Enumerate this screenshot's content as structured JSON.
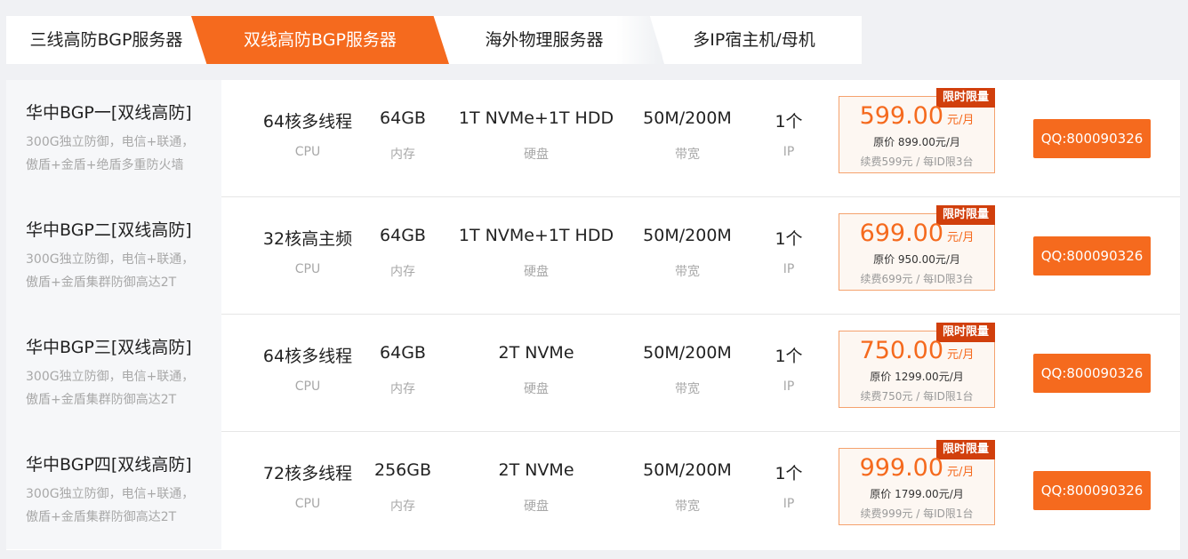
{
  "tabs": [
    {
      "label": "三线高防BGP服务器",
      "active": false
    },
    {
      "label": "双线高防BGP服务器",
      "active": true
    },
    {
      "label": "海外物理服务器",
      "active": false
    },
    {
      "label": "多IP宿主机/母机",
      "active": false
    }
  ],
  "colors": {
    "accent": "#f56a1e",
    "promo_badge": "#d13f0c"
  },
  "products": [
    {
      "name": "华中BGP一[双线高防]",
      "desc": "300G独立防御，电信+联通，傲盾+金盾+绝盾多重防火墙",
      "cpu": "64核多线程",
      "cpu_label": "CPU",
      "mem": "64GB",
      "mem_label": "内存",
      "disk": "1T NVMe+1T HDD",
      "disk_label": "硬盘",
      "bw": "50M/200M",
      "bw_label": "带宽",
      "ip": "1个",
      "ip_label": "IP",
      "badge": "限时限量",
      "price": "599.00",
      "unit": "元/月",
      "original": "原价 899.00元/月",
      "renew": "续费599元 / 每ID限3台",
      "contact": "QQ:800090326"
    },
    {
      "name": "华中BGP二[双线高防]",
      "desc": "300G独立防御，电信+联通，傲盾+金盾集群防御高达2T",
      "cpu": "32核高主频",
      "cpu_label": "CPU",
      "mem": "64GB",
      "mem_label": "内存",
      "disk": "1T NVMe+1T HDD",
      "disk_label": "硬盘",
      "bw": "50M/200M",
      "bw_label": "带宽",
      "ip": "1个",
      "ip_label": "IP",
      "badge": "限时限量",
      "price": "699.00",
      "unit": "元/月",
      "original": "原价 950.00元/月",
      "renew": "续费699元 / 每ID限3台",
      "contact": "QQ:800090326"
    },
    {
      "name": "华中BGP三[双线高防]",
      "desc": "300G独立防御，电信+联通，傲盾+金盾集群防御高达2T",
      "cpu": "64核多线程",
      "cpu_label": "CPU",
      "mem": "64GB",
      "mem_label": "内存",
      "disk": "2T NVMe",
      "disk_label": "硬盘",
      "bw": "50M/200M",
      "bw_label": "带宽",
      "ip": "1个",
      "ip_label": "IP",
      "badge": "限时限量",
      "price": "750.00",
      "unit": "元/月",
      "original": "原价 1299.00元/月",
      "renew": "续费750元 / 每ID限1台",
      "contact": "QQ:800090326"
    },
    {
      "name": "华中BGP四[双线高防]",
      "desc": "300G独立防御，电信+联通，傲盾+金盾集群防御高达2T",
      "cpu": "72核多线程",
      "cpu_label": "CPU",
      "mem": "256GB",
      "mem_label": "内存",
      "disk": "2T NVMe",
      "disk_label": "硬盘",
      "bw": "50M/200M",
      "bw_label": "带宽",
      "ip": "1个",
      "ip_label": "IP",
      "badge": "限时限量",
      "price": "999.00",
      "unit": "元/月",
      "original": "原价 1799.00元/月",
      "renew": "续费999元 / 每ID限1台",
      "contact": "QQ:800090326"
    }
  ]
}
